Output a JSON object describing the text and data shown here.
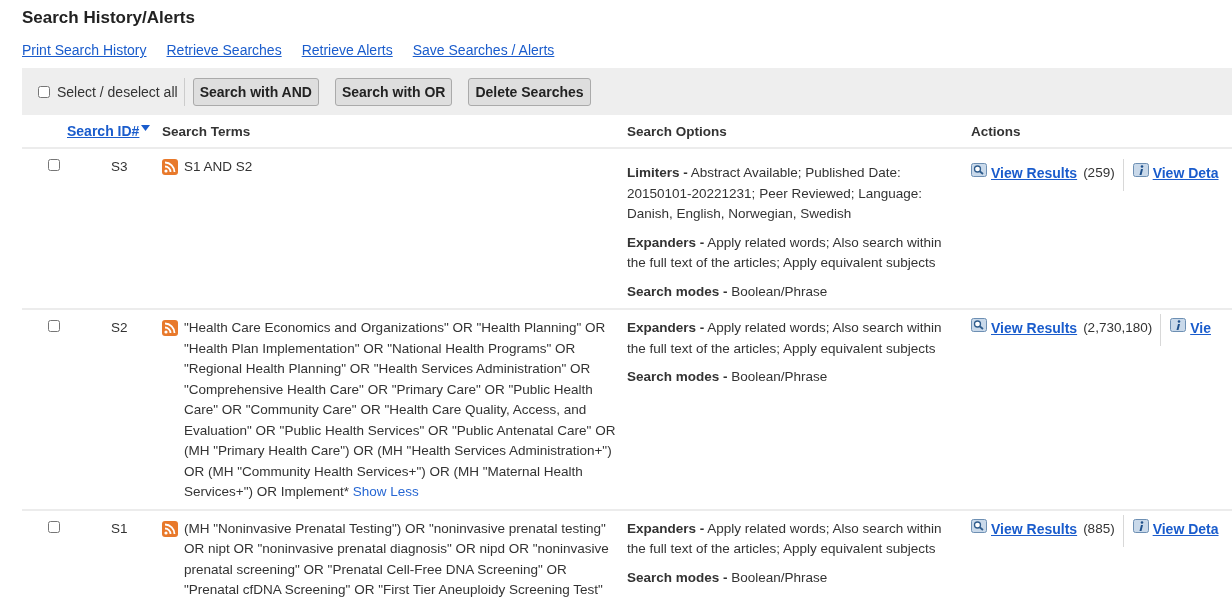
{
  "title": "Search History/Alerts",
  "links": [
    "Print Search History",
    "Retrieve Searches",
    "Retrieve Alerts",
    "Save Searches / Alerts"
  ],
  "toolbar": {
    "select_all": {
      "label": "Select / deselect all",
      "checked": false
    },
    "buttons": [
      "Search with AND",
      "Search with OR",
      "Delete Searches"
    ]
  },
  "table": {
    "columns": [
      {
        "label": "Search ID#",
        "kind": "sort_link"
      },
      {
        "label": "Search Terms",
        "kind": "plain"
      },
      {
        "label": "Search Options",
        "kind": "plain"
      },
      {
        "label": "Actions",
        "kind": "plain"
      }
    ],
    "rows": [
      {
        "id": "S3",
        "selected": false,
        "terms": "S1 AND S2",
        "options": [
          "**Limiters -** Abstract Available; Published Date: 20150101-20221231; Peer Reviewed; Language: Danish, English, Norwegian, Swedish",
          "**Expanders -** Apply related words; Also search within the full text of the articles; Apply equivalent subjects",
          "**Search modes -** Boolean/Phrase"
        ],
        "results_link": "View Results",
        "count": "(259)",
        "details_link": "View Deta"
      },
      {
        "id": "S2",
        "selected": false,
        "terms": "\"Health Care Economics and Organizations\" OR \"Health Planning\" OR \"Health Plan Implementation\" OR \"National Health Programs\" OR \"Regional Health Planning\" OR \"Health Services Administration\" OR \"Comprehensive Health Care\" OR \"Primary Care\" OR \"Public Health Care\" OR \"Community Care\" OR \"Health Care Quality, Access, and Evaluation\" OR \"Public Health Services\" OR \"Public Antenatal Care\" OR (MH \"Primary Health Care\") OR (MH \"Health Services Administration+\") OR (MH \"Community Health Services+\") OR (MH \"Maternal Health Services+\") OR Implement*",
        "toggle": "Show Less",
        "options": [
          "**Expanders -** Apply related words; Also search within the full text of the articles; Apply equivalent subjects",
          "**Search modes -** Boolean/Phrase"
        ],
        "results_link": "View Results",
        "count": "(2,730,180)",
        "details_link": "Vie"
      },
      {
        "id": "S1",
        "selected": false,
        "terms": "(MH \"Noninvasive Prenatal Testing\") OR \"noninvasive prenatal testing\" OR nipt OR \"noninvasive prenatal diagnosis\" OR nipd OR \"noninvasive prenatal screening\" OR \"Prenatal Cell-Free DNA Screening\" OR \"Prenatal cfDNA Screening\" OR \"First Tier Aneuploidy Screening Test\"",
        "options": [
          "**Expanders -** Apply related words; Also search within the full text of the articles; Apply equivalent subjects",
          "**Search modes -** Boolean/Phrase"
        ],
        "results_link": "View Results",
        "count": "(885)",
        "details_link": "View Deta"
      }
    ]
  }
}
